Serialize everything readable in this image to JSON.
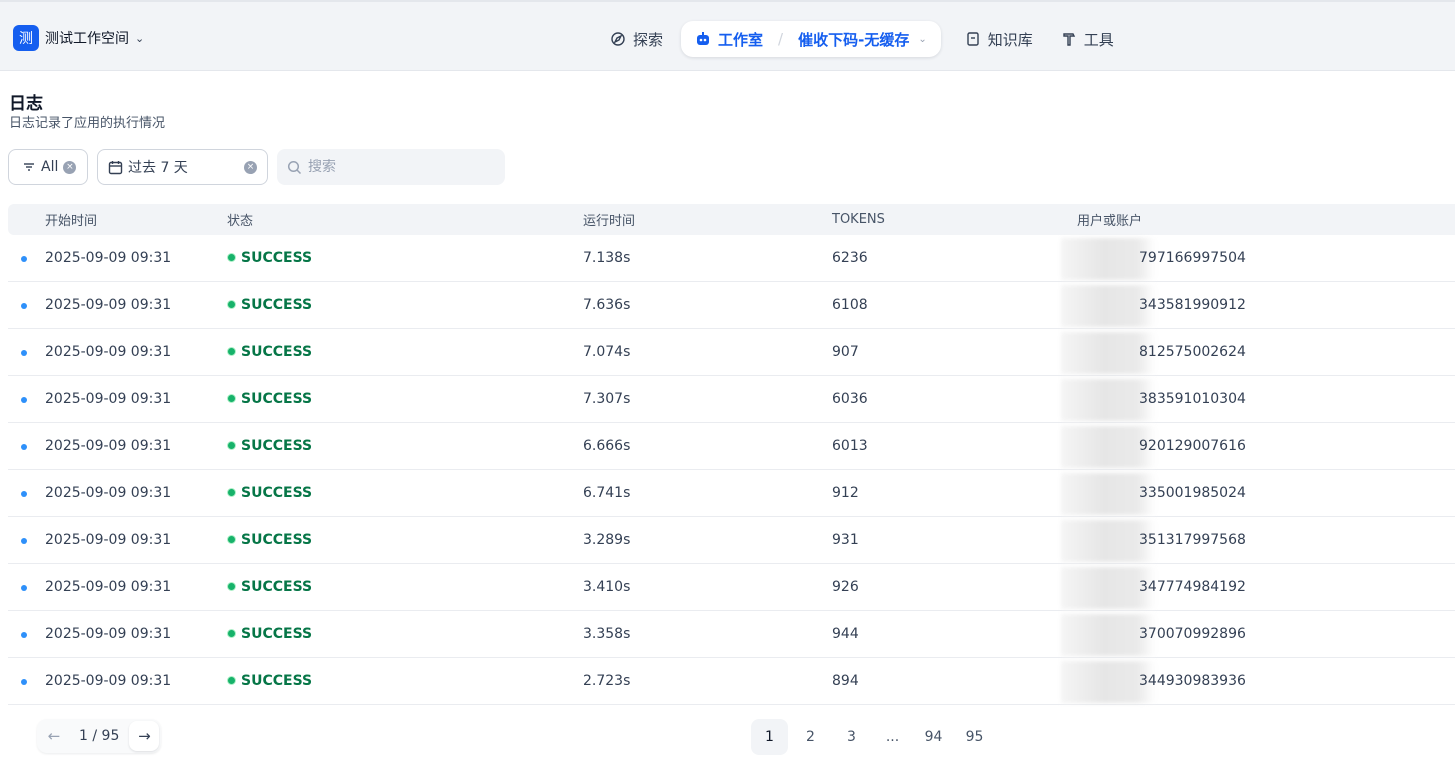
{
  "workspace": {
    "avatar": "测",
    "name": "测试工作空间"
  },
  "nav": {
    "explore": "探索",
    "studio": "工作室",
    "app_name": "催收下码-无缓存",
    "knowledge": "知识库",
    "tools": "工具"
  },
  "page": {
    "title": "日志",
    "subtitle": "日志记录了应用的执行情况"
  },
  "filters": {
    "status": "All",
    "period": "过去 7 天",
    "search_placeholder": "搜索"
  },
  "table": {
    "headers": [
      "开始时间",
      "状态",
      "运行时间",
      "TOKENS",
      "用户或账户"
    ],
    "rows": [
      {
        "time": "2025-09-09 09:31",
        "status": "SUCCESS",
        "duration": "7.138s",
        "tokens": "6236",
        "user": "797166997504"
      },
      {
        "time": "2025-09-09 09:31",
        "status": "SUCCESS",
        "duration": "7.636s",
        "tokens": "6108",
        "user": "343581990912"
      },
      {
        "time": "2025-09-09 09:31",
        "status": "SUCCESS",
        "duration": "7.074s",
        "tokens": "907",
        "user": "812575002624"
      },
      {
        "time": "2025-09-09 09:31",
        "status": "SUCCESS",
        "duration": "7.307s",
        "tokens": "6036",
        "user": "383591010304"
      },
      {
        "time": "2025-09-09 09:31",
        "status": "SUCCESS",
        "duration": "6.666s",
        "tokens": "6013",
        "user": "920129007616"
      },
      {
        "time": "2025-09-09 09:31",
        "status": "SUCCESS",
        "duration": "6.741s",
        "tokens": "912",
        "user": "335001985024"
      },
      {
        "time": "2025-09-09 09:31",
        "status": "SUCCESS",
        "duration": "3.289s",
        "tokens": "931",
        "user": "351317997568"
      },
      {
        "time": "2025-09-09 09:31",
        "status": "SUCCESS",
        "duration": "3.410s",
        "tokens": "926",
        "user": "347774984192"
      },
      {
        "time": "2025-09-09 09:31",
        "status": "SUCCESS",
        "duration": "3.358s",
        "tokens": "944",
        "user": "370070992896"
      },
      {
        "time": "2025-09-09 09:31",
        "status": "SUCCESS",
        "duration": "2.723s",
        "tokens": "894",
        "user": "344930983936"
      }
    ]
  },
  "pagination": {
    "current": "1",
    "separator": "/",
    "total": "95",
    "pages": [
      "1",
      "2",
      "3",
      "...",
      "94",
      "95"
    ]
  },
  "colors": {
    "accent": "#155eef",
    "success": "#067647",
    "success_dot": "#17b26a",
    "row_dot": "#2e90fa"
  }
}
